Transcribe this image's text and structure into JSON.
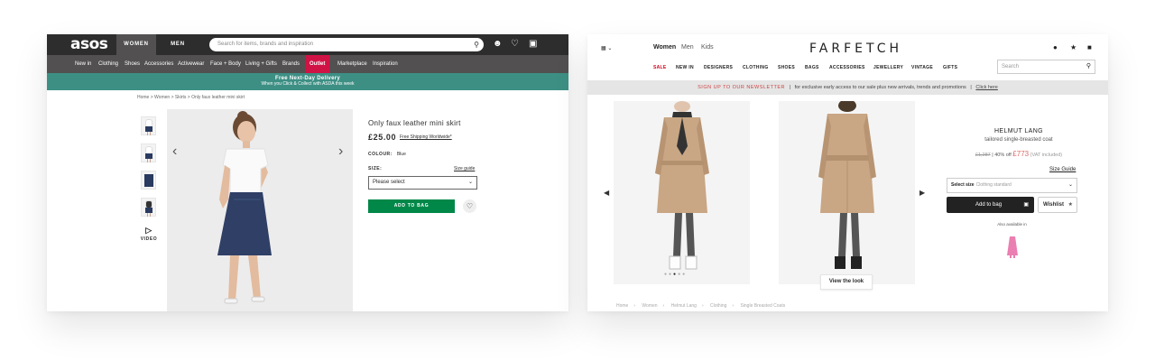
{
  "asos": {
    "logo": "asos",
    "gender_tabs": [
      "WOMEN",
      "MEN"
    ],
    "search_placeholder": "Search for items, brands and inspiration",
    "nav": [
      "New in",
      "Clothing",
      "Shoes",
      "Accessories",
      "Activewear",
      "Face + Body",
      "Living + Gifts",
      "Brands",
      "Outlet",
      "Marketplace",
      "Inspiration"
    ],
    "promo": {
      "title": "Free Next-Day Delivery",
      "subtitle": "When you Click & Collect with ASDA this week"
    },
    "breadcrumb": [
      "Home",
      "Women",
      "Skirts",
      "Only faux leather mini skirt"
    ],
    "video_label": "VIDEO",
    "product": {
      "title": "Only faux leather mini skirt",
      "price": "£25.00",
      "shipping": "Free Shipping Worldwide*",
      "colour_label": "COLOUR:",
      "colour_value": "Blue",
      "size_label": "SIZE:",
      "size_guide": "Size guide",
      "size_placeholder": "Please select",
      "add_to_bag": "ADD TO BAG"
    },
    "colors": {
      "topbar": "#2d2d2d",
      "nav": "#525050",
      "outlet": "#d01345",
      "promo": "#3d8f84",
      "add": "#018849"
    }
  },
  "farfetch": {
    "logo": "FARFETCH",
    "gender_tabs": [
      "Women",
      "Men",
      "Kids"
    ],
    "nav": [
      "SALE",
      "NEW IN",
      "DESIGNERS",
      "CLOTHING",
      "SHOES",
      "BAGS",
      "ACCESSORIES",
      "JEWELLERY",
      "VINTAGE",
      "GIFTS"
    ],
    "search_placeholder": "Search",
    "banner": {
      "cta": "SIGN UP TO OUR NEWSLETTER",
      "sep": "|",
      "text": "for exclusive early access to our sale plus new arrivals, trends and promotions",
      "link": "Click here"
    },
    "view_the_look": "View the look",
    "product": {
      "brand": "HELMUT LANG",
      "description": "tailored single-breasted coat",
      "old_price": "£1,287",
      "discount": "| 40% off",
      "price": "£773",
      "vat": "(VAT included)",
      "size_guide": "Size Guide",
      "select_size": "Select size",
      "size_standard": "Clothing standard",
      "add_to_bag": "Add to bag",
      "wishlist": "Wishlist",
      "also_available": "Also available in"
    },
    "breadcrumb": [
      "Home",
      "Women",
      "Helmut Lang",
      "Clothing",
      "Single Breasted Coats"
    ],
    "colors": {
      "sale": "#d0021b",
      "banner": "#e5e5e5",
      "coat": "#c9a684"
    }
  }
}
